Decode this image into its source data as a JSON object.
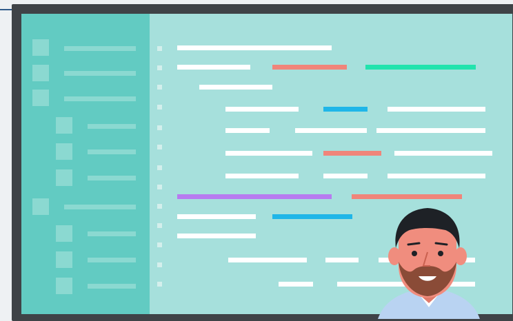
{
  "colors": {
    "frame": "#3f4347",
    "editor_bg": "#a6e0dc",
    "sidebar_bg": "#62cbc2",
    "sidebar_item": "#8bd9d1",
    "code_default": "#ffffff",
    "code_red": "#f0857a",
    "code_green": "#22e3ad",
    "code_blue": "#1fb6e8",
    "code_purple": "#b77bf0",
    "skin": "#f08d7e",
    "beard": "#8a4b37",
    "hair": "#1e2126",
    "shirt": "#b9d3f2"
  },
  "icons": [
    "file-tree-placeholder",
    "code-line-placeholder",
    "developer-avatar"
  ]
}
